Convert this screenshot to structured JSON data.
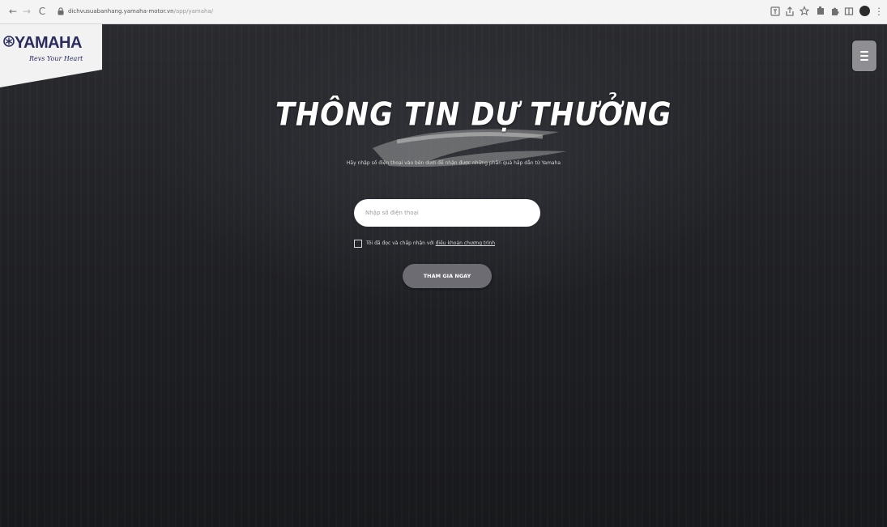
{
  "browser": {
    "url_domain": "dichvusuabanhang.yamaha-motor.vn",
    "url_path": "/app/yamaha/",
    "nav_back": "←",
    "nav_forward": "→",
    "nav_reload": "C",
    "menu_glyph": "⋮"
  },
  "brand": {
    "logo_text": "YAMAHA",
    "tagline": "Revs Your Heart",
    "colors": {
      "logo": "#2b2c5e",
      "button": "#6c6c72",
      "menu": "#8e8e93"
    }
  },
  "form": {
    "title": "THÔNG TIN DỰ THƯỞNG",
    "subtitle": "Hãy nhập số điện thoại vào bên dưới để nhận được những phần quà hấp dẫn từ Yamaha",
    "phone_placeholder": "Nhập số điện thoại",
    "phone_value": "",
    "agree_prefix": "Tôi đã đọc và chấp nhận với ",
    "agree_link": "điều khoản chương trình",
    "agree_checked": false,
    "submit_label": "THAM GIA NGAY"
  },
  "icons": {
    "back": "arrow-left-icon",
    "forward": "arrow-right-icon",
    "reload": "reload-icon",
    "lock": "lock-icon",
    "menu": "hamburger-menu-icon"
  }
}
